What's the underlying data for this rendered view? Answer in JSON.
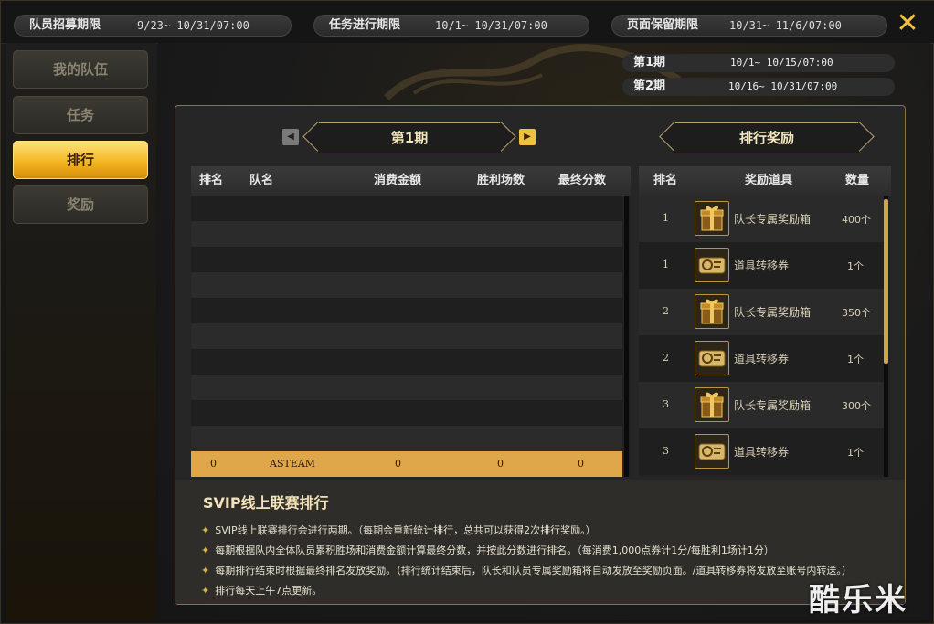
{
  "topbar": {
    "recruit": {
      "label": "队员招募期限",
      "value": "9/23~ 10/31/07:00"
    },
    "mission": {
      "label": "任务进行期限",
      "value": "10/1~ 10/31/07:00"
    },
    "keep": {
      "label": "页面保留期限",
      "value": "10/31~ 11/6/07:00"
    },
    "close_icon": "close-icon"
  },
  "sidebar": {
    "items": [
      {
        "label": "我的队伍",
        "active": false
      },
      {
        "label": "任务",
        "active": false
      },
      {
        "label": "排行",
        "active": true
      },
      {
        "label": "奖励",
        "active": false
      }
    ]
  },
  "periods": [
    {
      "label": "第1期",
      "value": "10/1~ 10/15/07:00"
    },
    {
      "label": "第2期",
      "value": "10/16~ 10/31/07:00"
    }
  ],
  "ranking": {
    "period_title": "第1期",
    "columns": [
      "排名",
      "队名",
      "消费金额",
      "胜利场数",
      "最终分数"
    ],
    "my_row": {
      "rank": "0",
      "team": "ASTEAM",
      "spend": "0",
      "wins": "0",
      "score": "0"
    }
  },
  "rewards": {
    "title": "排行奖励",
    "columns": [
      "排名",
      "奖励道具",
      "数量"
    ],
    "items": [
      {
        "rank": "1",
        "name": "队长专属奖励箱",
        "qty": "400个",
        "icon": "gift-box-icon"
      },
      {
        "rank": "1",
        "name": "道具转移券",
        "qty": "1个",
        "icon": "ticket-icon"
      },
      {
        "rank": "2",
        "name": "队长专属奖励箱",
        "qty": "350个",
        "icon": "gift-box-icon"
      },
      {
        "rank": "2",
        "name": "道具转移券",
        "qty": "1个",
        "icon": "ticket-icon"
      },
      {
        "rank": "3",
        "name": "队长专属奖励箱",
        "qty": "300个",
        "icon": "gift-box-icon"
      },
      {
        "rank": "3",
        "name": "道具转移券",
        "qty": "1个",
        "icon": "ticket-icon"
      }
    ]
  },
  "description": {
    "title": "SVIP线上联赛排行",
    "bullets": [
      "SVIP线上联赛排行会进行两期。（每期会重新统计排行，总共可以获得2次排行奖励。）",
      "每期根据队内全体队员累积胜场和消费金额计算最终分数，并按此分数进行排名。（每消费1,000点券计1分/每胜利1场计1分）",
      "每期排行结束时根据最终排名发放奖励。（排行统计结束后，队长和队员专属奖励箱将自动发放至奖励页面。/道具转移券将发放至账号内转送。）",
      "排行每天上午7点更新。"
    ]
  },
  "watermark": "酷乐米",
  "colors": {
    "accent": "#f3b21e",
    "highlight_row": "#e0a64a",
    "border_gold": "#8a7540"
  }
}
